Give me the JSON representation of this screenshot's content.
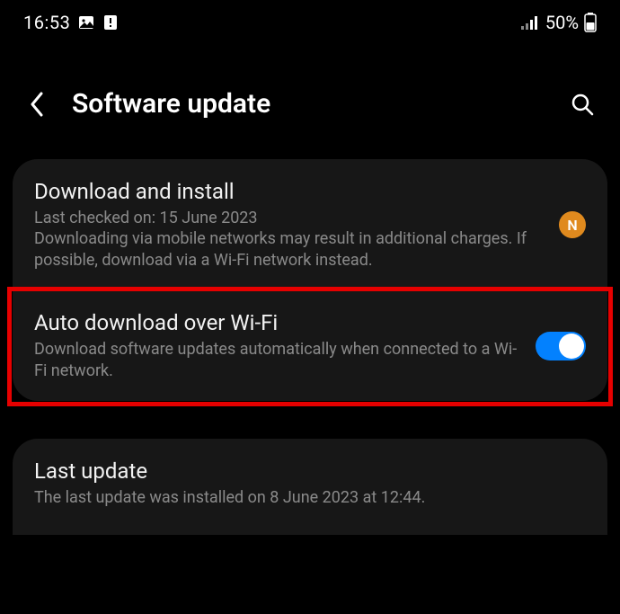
{
  "status": {
    "time": "16:53",
    "battery_pct": "50%"
  },
  "header": {
    "title": "Software update"
  },
  "download_install": {
    "title": "Download and install",
    "last_checked": "Last checked on: 15 June 2023",
    "desc": "Downloading via mobile networks may result in additional charges. If possible, download via a Wi-Fi network instead.",
    "badge": "N"
  },
  "auto_download": {
    "title": "Auto download over Wi-Fi",
    "desc": "Download software updates automatically when connected to a Wi-Fi network.",
    "toggle_on": true
  },
  "last_update": {
    "title": "Last update",
    "desc": "The last update was installed on 8 June 2023 at 12:44."
  }
}
